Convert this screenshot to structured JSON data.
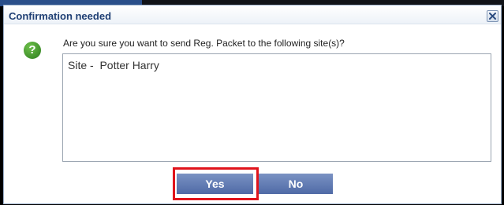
{
  "dialog": {
    "title": "Confirmation needed",
    "close_icon": "close-icon",
    "question_icon": "question-icon",
    "question_glyph": "?",
    "message": "Are you sure you want to send Reg. Packet to the following site(s)?",
    "sites_text": "Site -  Potter Harry",
    "buttons": {
      "yes": "Yes",
      "no": "No"
    }
  },
  "colors": {
    "title_text": "#1f3f74",
    "button_bg": "#5b74ad",
    "highlight": "#e0141c",
    "icon_green": "#3c8f28"
  }
}
